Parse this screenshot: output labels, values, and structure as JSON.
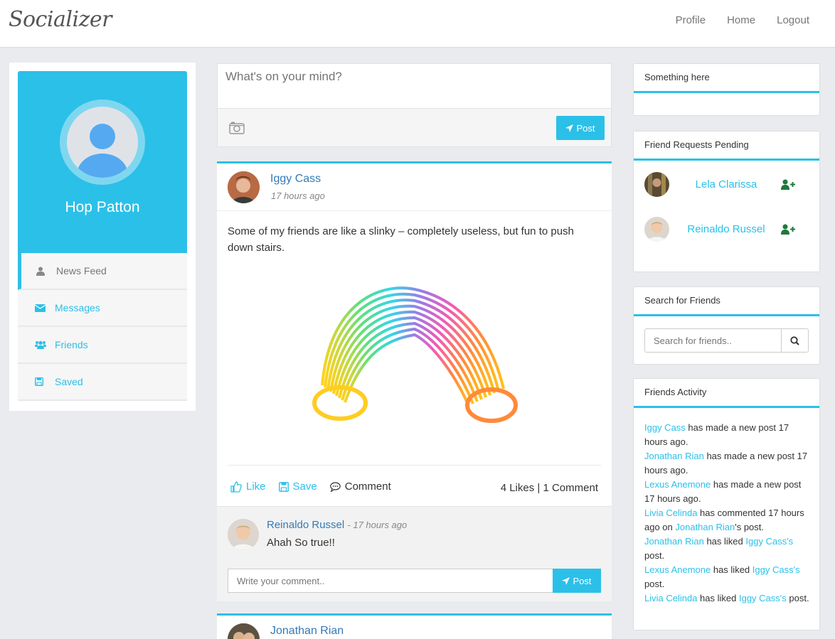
{
  "brand": "Socializer",
  "nav": {
    "profile": "Profile",
    "home": "Home",
    "logout": "Logout"
  },
  "profile": {
    "name": "Hop Patton"
  },
  "sidebar": {
    "items": [
      {
        "label": "News Feed",
        "icon": "user-icon"
      },
      {
        "label": "Messages",
        "icon": "envelope-icon"
      },
      {
        "label": "Friends",
        "icon": "users-icon"
      },
      {
        "label": "Saved",
        "icon": "floppy-icon"
      }
    ]
  },
  "composer": {
    "placeholder": "What's on your mind?",
    "post_label": "Post"
  },
  "post": {
    "author": "Iggy Cass",
    "time": "17 hours ago",
    "text": "Some of my friends are like a slinky – completely useless, but fun to push down stairs.",
    "like_label": "Like",
    "save_label": "Save",
    "comment_label": "Comment",
    "stats": "4 Likes | 1 Comment",
    "comment": {
      "author": "Reinaldo Russel",
      "time": "- 17 hours ago",
      "text": "Ahah So true!!"
    },
    "comment_placeholder": "Write your comment..",
    "comment_post_label": "Post"
  },
  "post2": {
    "author": "Jonathan Rian"
  },
  "panels": {
    "something": {
      "title": "Something here"
    },
    "requests": {
      "title": "Friend Requests Pending",
      "items": [
        {
          "name": "Lela Clarissa"
        },
        {
          "name": "Reinaldo Russel"
        }
      ]
    },
    "search": {
      "title": "Search for Friends",
      "placeholder": "Search for friends.."
    },
    "activity": {
      "title": "Friends Activity",
      "entries": [
        {
          "link1": "Iggy Cass",
          "text1": " has made a new post 17 hours ago."
        },
        {
          "link1": "Jonathan Rian",
          "text1": " has made a new post 17 hours ago."
        },
        {
          "link1": "Lexus Anemone",
          "text1": " has made a new post 17 hours ago."
        },
        {
          "link1": "Livia Celinda",
          "text1": " has commented 17 hours ago on ",
          "link2": "Jonathan Rian",
          "text2": "'s post."
        },
        {
          "link1": "Jonathan Rian",
          "text1": " has liked ",
          "link2": "Iggy Cass's",
          "text2": " post."
        },
        {
          "link1": "Lexus Anemone",
          "text1": " has liked ",
          "link2": "Iggy Cass's",
          "text2": " post."
        },
        {
          "link1": "Livia Celinda",
          "text1": " has liked ",
          "link2": "Iggy Cass's",
          "text2": " post."
        }
      ]
    }
  },
  "colors": {
    "accent": "#2bc0e8",
    "link": "#337ab7",
    "background": "#e9ebee",
    "add_icon": "#1e7a3a"
  }
}
